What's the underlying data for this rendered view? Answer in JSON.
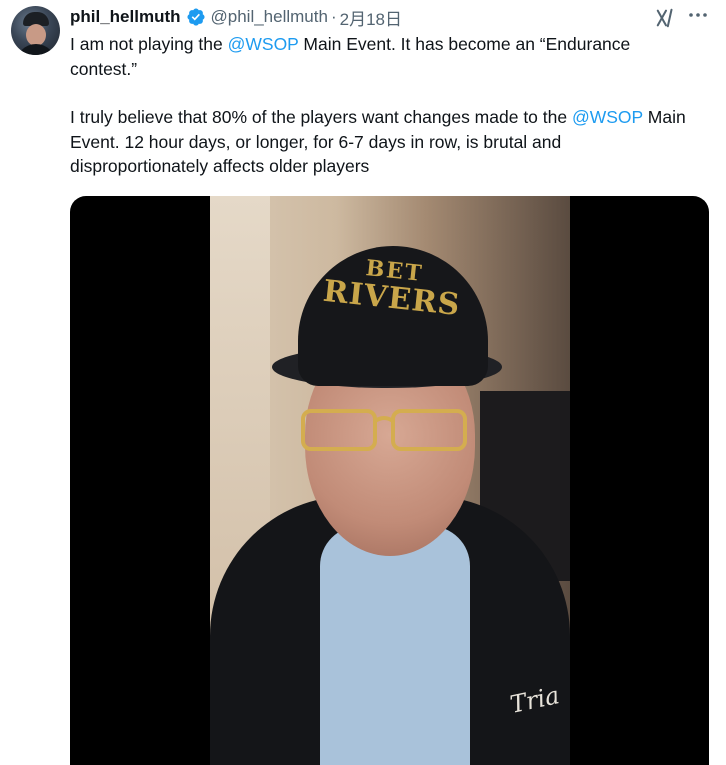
{
  "tweet": {
    "author": {
      "display_name": "phil_hellmuth",
      "handle": "@phil_hellmuth",
      "separator": "·",
      "date": "2月18日",
      "verified": true
    },
    "paragraphs": [
      {
        "segments": [
          {
            "text": "I am not playing the ",
            "mention": false
          },
          {
            "text": "@WSOP",
            "mention": true
          },
          {
            "text": " Main Event. It has become an “Endurance contest.”",
            "mention": false
          }
        ]
      },
      {
        "segments": [
          {
            "text": "I truly believe that 80% of the players want changes made to the ",
            "mention": false
          },
          {
            "text": "@WSOP",
            "mention": true
          },
          {
            "text": " Main Event. 12 hour days, or longer, for 6-7 days in row, is brutal and disproportionately affects older players",
            "mention": false
          }
        ]
      }
    ],
    "media": {
      "type": "video",
      "hat_text_line1": "BET",
      "hat_text_line2": "RIVERS",
      "jacket_text": "Tria"
    }
  },
  "icons": {
    "verified": "verified-badge-icon",
    "grok": "grok-icon",
    "more": "more-icon"
  },
  "colors": {
    "text": "#0f1419",
    "secondary_text": "#536471",
    "mention": "#1d9bf0",
    "verified_badge": "#1d9bf0"
  }
}
